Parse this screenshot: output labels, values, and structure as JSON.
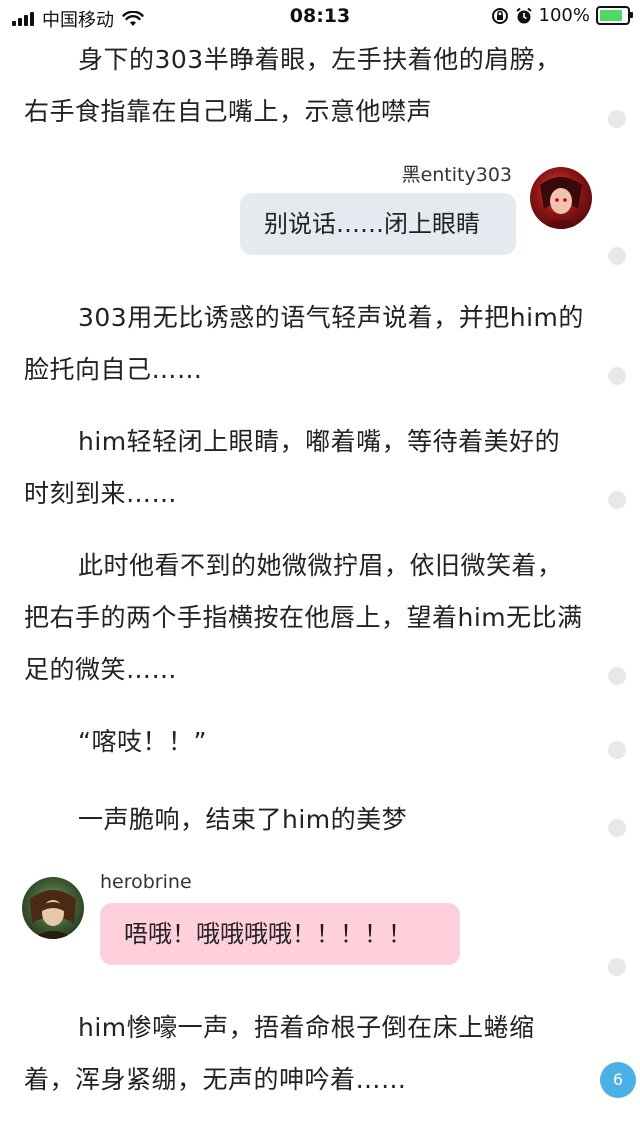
{
  "status_bar": {
    "carrier": "中国移动",
    "time": "08:13",
    "battery_percent": "100%",
    "icons": [
      "signal-icon",
      "wifi-icon",
      "rotation-lock-icon",
      "alarm-icon",
      "battery-charging-icon"
    ]
  },
  "story": {
    "p1": "身下的303半睁着眼，左手扶着他的肩膀，右手食指靠在自己嘴上，示意他噤声",
    "p2": "303用无比诱惑的语气轻声说着，并把him的脸托向自己……",
    "p3": "him轻轻闭上眼睛，嘟着嘴，等待着美好的时刻到来……",
    "p4": "此时他看不到的她微微拧眉，依旧微笑着，把右手的两个手指横按在他唇上，望着him无比满足的微笑……",
    "p5": "“喀吱！！”",
    "p6": "一声脆响，结束了him的美梦",
    "p7": "him惨嚎一声，捂着命根子倒在床上蜷缩着，浑身紧绷，无声的呻吟着……"
  },
  "chat": {
    "msg1": {
      "name": "黑entity303",
      "text": "别说话……闭上眼睛",
      "side": "right"
    },
    "msg2": {
      "name": "herobrine",
      "text": "唔哦！哦哦哦哦！！！！！",
      "side": "left"
    }
  },
  "comment_badge": {
    "count": "6"
  },
  "colors": {
    "right_bubble": "#e5e9f0",
    "left_bubble": "#ffd0dc",
    "badge": "#4ab0e6",
    "battery": "#4cd964"
  }
}
